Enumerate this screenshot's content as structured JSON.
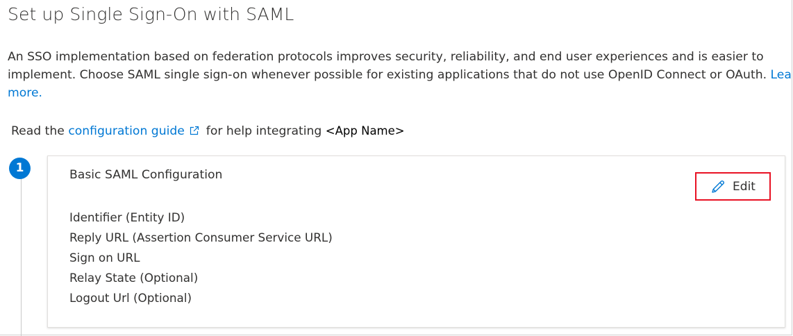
{
  "page": {
    "title": "Set up Single Sign-On with SAML"
  },
  "intro": {
    "line1": "An SSO implementation based on federation protocols improves security, reliability, and end user experiences and is easier to",
    "line2_text": "implement. Choose SAML single sign-on whenever possible for existing applications that do not use OpenID Connect or OAuth. ",
    "learn_link_part1": "Lea",
    "learn_link_part2": "more."
  },
  "guide": {
    "prefix": "Read the ",
    "link_label": "configuration guide",
    "middle": " for help integrating ",
    "app_name": "<App Name>"
  },
  "step": {
    "number": "1"
  },
  "card": {
    "title": "Basic SAML Configuration",
    "edit_label": "Edit",
    "fields": [
      "Identifier (Entity ID)",
      "Reply URL (Assertion Consumer Service URL)",
      "Sign on URL",
      "Relay State (Optional)",
      "Logout Url (Optional)"
    ]
  },
  "colors": {
    "accent": "#0078d4",
    "highlight": "#e81123",
    "text": "#323130"
  },
  "icons": {
    "external_link": "external-link-icon",
    "edit": "pencil-icon"
  }
}
